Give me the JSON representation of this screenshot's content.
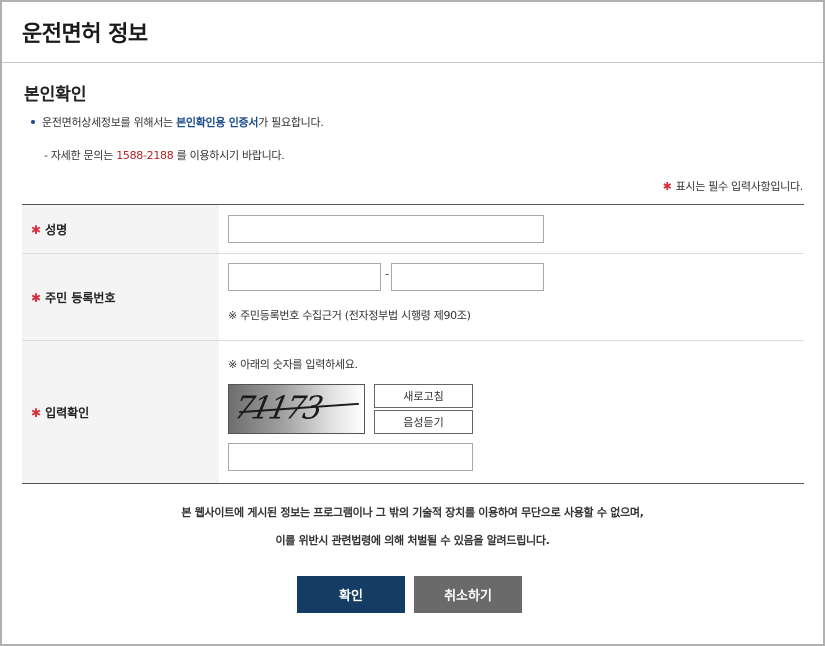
{
  "page_title": "운전면허 정보",
  "section": {
    "title": "본인확인",
    "note_prefix": "운전면허상세정보를 위해서는 ",
    "note_emphasis": "본인확인용 인증서",
    "note_suffix": "가 필요합니다.",
    "inquiry_prefix": "- 자세한 문의는 ",
    "inquiry_phone": "1588-2188",
    "inquiry_suffix": " 를 이용하시기 바랍니다.",
    "required_legend": "표시는 필수 입력사항입니다."
  },
  "required_mark": "✱",
  "colors": {
    "primary": "#143c64",
    "secondary_button": "#6a6a6a",
    "required": "#d62d3c",
    "emphasis": "#1f4e8c",
    "phone": "#b22222"
  },
  "form": {
    "name": {
      "label": "성명",
      "value": ""
    },
    "rrn": {
      "label": "주민 등록번호",
      "first_value": "",
      "second_value": "",
      "separator": "-",
      "note": "※ 주민등록번호 수집근거 (전자정부법 시행령 제90조)"
    },
    "captcha": {
      "label": "입력확인",
      "instruction": "※ 아래의 숫자를 입력하세요.",
      "image_text": "71173",
      "refresh_label": "새로고침",
      "listen_label": "음성듣기",
      "value": ""
    }
  },
  "legal": {
    "line1": "본 웹사이트에 게시된 정보는 프로그램이나 그 밖의 기술적 장치를 이용하여 무단으로 사용할 수 없으며,",
    "line2": "이를 위반시 관련법령에 의해 처벌될 수 있음을 알려드립니다."
  },
  "buttons": {
    "confirm": "확인",
    "cancel": "취소하기"
  }
}
